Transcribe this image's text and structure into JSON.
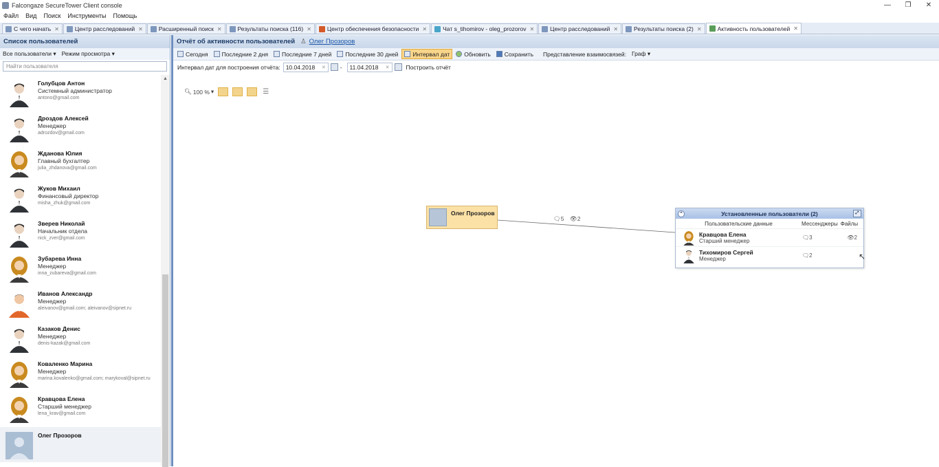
{
  "window": {
    "title": "Falcongaze SecureTower Client console",
    "controls": [
      "—",
      "❐",
      "✕"
    ]
  },
  "menu": [
    "Файл",
    "Вид",
    "Поиск",
    "Инструменты",
    "Помощь"
  ],
  "tabs": [
    {
      "label": "С чего начать",
      "icon": "home-icon",
      "active": false
    },
    {
      "label": "Центр расследований",
      "icon": "investigation-icon",
      "active": false
    },
    {
      "label": "Расширенный поиск",
      "icon": "search-icon",
      "active": false
    },
    {
      "label": "Результаты поиска (116)",
      "icon": "results-icon",
      "active": false
    },
    {
      "label": "Центр обеспечения безопасности",
      "icon": "security-icon",
      "active": false
    },
    {
      "label": "Чат s_tihomirov - oleg_prozorov",
      "icon": "chat-icon",
      "active": false
    },
    {
      "label": "Центр расследований",
      "icon": "investigation-icon",
      "active": false
    },
    {
      "label": "Результаты поиска (2)",
      "icon": "results-icon",
      "active": false
    },
    {
      "label": "Активность пользователей",
      "icon": "activity-icon",
      "active": true
    }
  ],
  "left": {
    "header": "Список пользователей",
    "filter_users": "Все пользователи ▾",
    "view_mode": "Режим просмотра ▾",
    "search_placeholder": "Найти пользователя",
    "users": [
      {
        "name": "Голубцов Антон",
        "role": "Системный администратор",
        "email": "antono@gmail.com",
        "avatar": "male"
      },
      {
        "name": "Дроздов Алексей",
        "role": "Менеджер",
        "email": "adrozdov@gmail.com",
        "avatar": "male"
      },
      {
        "name": "Жданова Юлия",
        "role": "Главный бухгалтер",
        "email": "julia_zhdanova@gmail.com",
        "avatar": "female"
      },
      {
        "name": "Жуков Михаил",
        "role": "Финансовый директор",
        "email": "misha_zhuk@gmail.com",
        "avatar": "male"
      },
      {
        "name": "Зверев Николай",
        "role": "Начальник отдела",
        "email": "nick_zver@gmail.com",
        "avatar": "male"
      },
      {
        "name": "Зубарева Инна",
        "role": "Менеджер",
        "email": "inna_zubareva@gmail.com",
        "avatar": "female"
      },
      {
        "name": "Иванов Александр",
        "role": "Менеджер",
        "email": "aleivanov@gmail.com; aleivanov@sipnet.ru",
        "avatar": "male-orange"
      },
      {
        "name": "Казаков Денис",
        "role": "Менеджер",
        "email": "denis-kazak@gmail.com",
        "avatar": "male"
      },
      {
        "name": "Коваленко Марина",
        "role": "Менеджер",
        "email": "marina.kovalenko@gmail.com; marykoval@sipnet.ru",
        "avatar": "female"
      },
      {
        "name": "Кравцова Елена",
        "role": "Старший менеджер",
        "email": "lena_krav@gmail.com",
        "avatar": "female"
      },
      {
        "name": "Олег Прозоров",
        "role": "",
        "email": "",
        "avatar": "photo"
      }
    ]
  },
  "main": {
    "title": "Отчёт об активности пользователей",
    "user_link": "Олег Прозоров",
    "toolbar": [
      "Сегодня",
      "Последние 2 дня",
      "Последние 7 дней",
      "Последние 30 дней",
      "Интервал дат",
      "Обновить",
      "Сохранить"
    ],
    "active_range": "Интервал дат",
    "relation_label": "Представление взаимосвязей:",
    "relation_value": "Граф ▾",
    "date_label": "Интервал дат для построения отчёта:",
    "date_from": "10.04.2018",
    "date_sep": "-",
    "date_to": "11.04.2018",
    "build_label": "Построить отчёт",
    "zoom": "100 %"
  },
  "graph": {
    "center_user": "Олег Прозоров",
    "edge_messengers": "5",
    "edge_files": "2",
    "panel": {
      "title": "Установленные пользователи (2)",
      "col_user": "Пользовательские данные",
      "col_messengers": "Мессенджеры",
      "col_files": "Файлы",
      "rows": [
        {
          "name": "Кравцова Елена",
          "role": "Старший менеджер",
          "messengers": "3",
          "files": "2",
          "avatar": "female"
        },
        {
          "name": "Тихомиров Сергей",
          "role": "Менеджер",
          "messengers": "2",
          "files": "",
          "avatar": "male"
        }
      ]
    }
  },
  "colors": {
    "accent": "#6d8fc0",
    "header_bg": "#c9d7ea",
    "node_bg": "#fbe1a6",
    "active_btn": "#f9d58a"
  }
}
